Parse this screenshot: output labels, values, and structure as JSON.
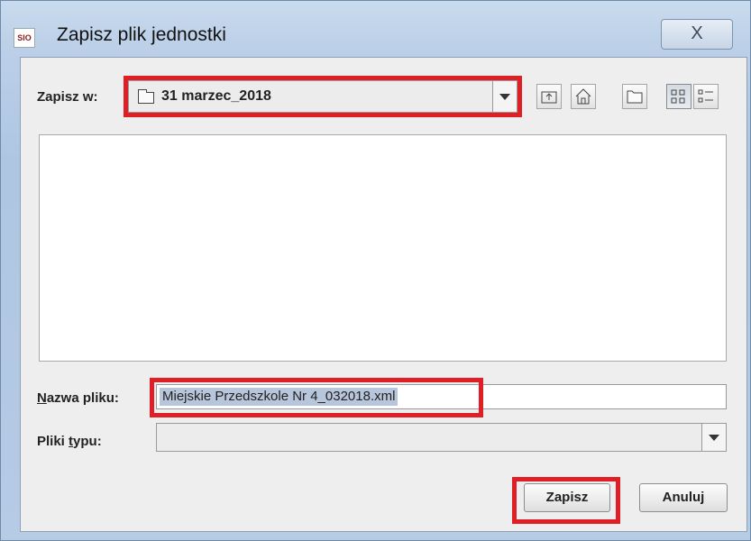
{
  "window": {
    "app_icon_text": "SIO",
    "title": "Zapisz plik jednostki",
    "close_symbol": "X"
  },
  "save_in": {
    "label": "Zapisz w:",
    "label_underlined_char_index": 4,
    "folder_icon": "folder-icon",
    "value": "31 marzec_2018"
  },
  "toolbar": {
    "buttons": [
      {
        "name": "up-one-level",
        "icon": "folder-up-icon"
      },
      {
        "name": "home",
        "icon": "home-icon"
      },
      {
        "name": "new-folder",
        "icon": "new-folder-icon"
      },
      {
        "name": "list-view",
        "icon": "list-view-icon",
        "pressed": true
      },
      {
        "name": "details-view",
        "icon": "details-view-icon"
      }
    ]
  },
  "file_list": {
    "items": []
  },
  "file_name": {
    "label_prefix": "N",
    "label_rest": "azwa pliku:",
    "value": "Miejskie Przedszkole Nr 4_032018.xml"
  },
  "file_type": {
    "label_prefix": "Pliki ",
    "label_underlined": "t",
    "label_rest": "ypu:",
    "value": ""
  },
  "actions": {
    "save_label": "Zapisz",
    "cancel_label": "Anuluj"
  },
  "colors": {
    "highlight": "#e01e26",
    "selection": "#b7c6da",
    "dialog_bg": "#eeeeee"
  }
}
